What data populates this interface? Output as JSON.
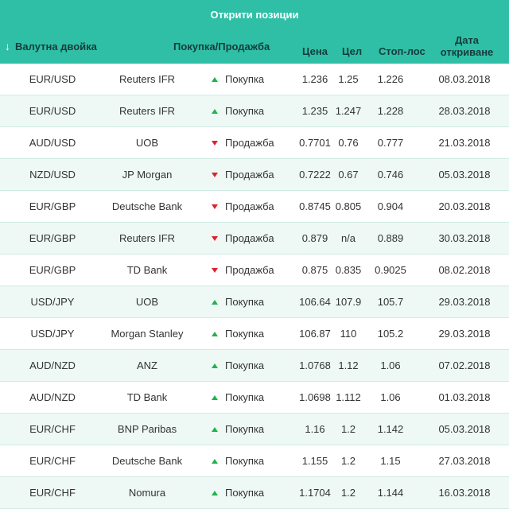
{
  "title": "Открити позиции",
  "headers": {
    "sort_arrow": "↓",
    "pair": "Валутна двойка",
    "side": "Покупка/Продажба",
    "price": "Цена",
    "target": "Цел",
    "stop": "Стоп-лос",
    "date_line1": "Дата",
    "date_line2": "откриване"
  },
  "colors": {
    "header_bg": "#2fbfa6",
    "buy_arrow": "#22b24c",
    "sell_arrow": "#e2202a",
    "row_alt": "#eef9f6"
  },
  "rows": [
    {
      "pair": "EUR/USD",
      "source": "Reuters IFR",
      "side": "Покупка",
      "dir": "up",
      "price": "1.236",
      "target": "1.25",
      "stop": "1.226",
      "date": "08.03.2018"
    },
    {
      "pair": "EUR/USD",
      "source": "Reuters IFR",
      "side": "Покупка",
      "dir": "up",
      "price": "1.235",
      "target": "1.247",
      "stop": "1.228",
      "date": "28.03.2018"
    },
    {
      "pair": "AUD/USD",
      "source": "UOB",
      "side": "Продажба",
      "dir": "down",
      "price": "0.7701",
      "target": "0.76",
      "stop": "0.777",
      "date": "21.03.2018"
    },
    {
      "pair": "NZD/USD",
      "source": "JP Morgan",
      "side": "Продажба",
      "dir": "down",
      "price": "0.7222",
      "target": "0.67",
      "stop": "0.746",
      "date": "05.03.2018"
    },
    {
      "pair": "EUR/GBP",
      "source": "Deutsche Bank",
      "side": "Продажба",
      "dir": "down",
      "price": "0.8745",
      "target": "0.805",
      "stop": "0.904",
      "date": "20.03.2018"
    },
    {
      "pair": "EUR/GBP",
      "source": "Reuters IFR",
      "side": "Продажба",
      "dir": "down",
      "price": "0.879",
      "target": "n/a",
      "stop": "0.889",
      "date": "30.03.2018"
    },
    {
      "pair": "EUR/GBP",
      "source": "TD Bank",
      "side": "Продажба",
      "dir": "down",
      "price": "0.875",
      "target": "0.835",
      "stop": "0.9025",
      "date": "08.02.2018"
    },
    {
      "pair": "USD/JPY",
      "source": "UOB",
      "side": "Покупка",
      "dir": "up",
      "price": "106.64",
      "target": "107.9",
      "stop": "105.7",
      "date": "29.03.2018"
    },
    {
      "pair": "USD/JPY",
      "source": "Morgan Stanley",
      "side": "Покупка",
      "dir": "up",
      "price": "106.87",
      "target": "110",
      "stop": "105.2",
      "date": "29.03.2018"
    },
    {
      "pair": "AUD/NZD",
      "source": "ANZ",
      "side": "Покупка",
      "dir": "up",
      "price": "1.0768",
      "target": "1.12",
      "stop": "1.06",
      "date": "07.02.2018"
    },
    {
      "pair": "AUD/NZD",
      "source": "TD Bank",
      "side": "Покупка",
      "dir": "up",
      "price": "1.0698",
      "target": "1.112",
      "stop": "1.06",
      "date": "01.03.2018"
    },
    {
      "pair": "EUR/CHF",
      "source": "BNP Paribas",
      "side": "Покупка",
      "dir": "up",
      "price": "1.16",
      "target": "1.2",
      "stop": "1.142",
      "date": "05.03.2018"
    },
    {
      "pair": "EUR/CHF",
      "source": "Deutsche Bank",
      "side": "Покупка",
      "dir": "up",
      "price": "1.155",
      "target": "1.2",
      "stop": "1.15",
      "date": "27.03.2018"
    },
    {
      "pair": "EUR/CHF",
      "source": "Nomura",
      "side": "Покупка",
      "dir": "up",
      "price": "1.1704",
      "target": "1.2",
      "stop": "1.144",
      "date": "16.03.2018"
    }
  ]
}
